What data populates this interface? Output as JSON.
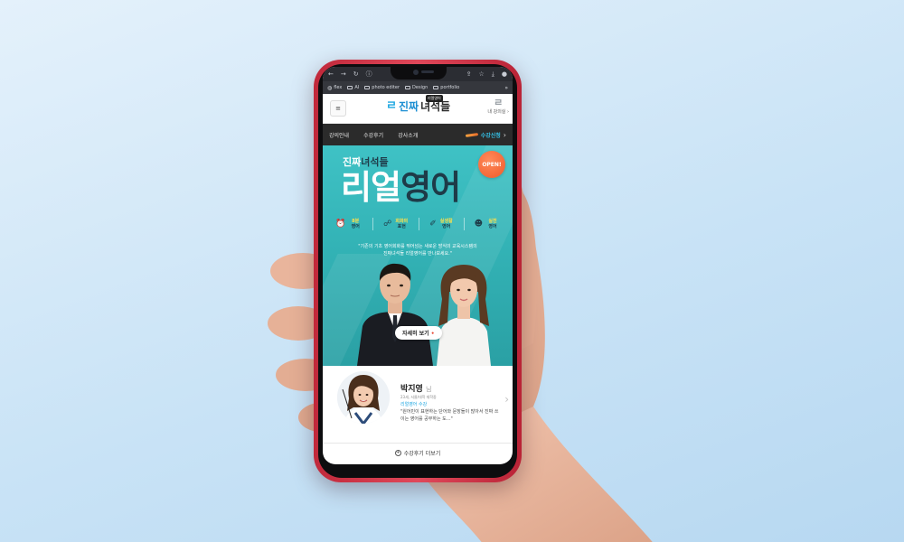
{
  "browser": {
    "nav_icons": [
      "back-icon",
      "forward-icon",
      "reload-icon",
      "info-icon",
      "share-icon",
      "star-icon",
      "download-icon",
      "profile-icon"
    ],
    "bookmarks": [
      {
        "label": "flex",
        "icon": "globe-icon"
      },
      {
        "label": "AI",
        "icon": "folder-icon"
      },
      {
        "label": "photo editer",
        "icon": "folder-icon"
      },
      {
        "label": "Design",
        "icon": "folder-icon"
      },
      {
        "label": "portfolio",
        "icon": "folder-icon"
      }
    ],
    "more": "»"
  },
  "header": {
    "menu_icon": "≡",
    "logo_mark": "ㄹ",
    "logo_part1": "진짜",
    "logo_part2": "녀석들",
    "logo_tag": "리얼영어",
    "mylec_icon": "ㄹ",
    "mylec_label": "내 강의실 ›"
  },
  "nav": {
    "items": [
      "강의안내",
      "수강후기",
      "강사소개"
    ],
    "enroll_label": "수강신청",
    "enroll_arrow": "›"
  },
  "hero": {
    "subtitle_part1": "진짜",
    "subtitle_part2": "녀석들",
    "badge": "OPEN!",
    "title_part1": "리얼",
    "title_part2": "영어",
    "features": [
      {
        "icon": "⏰",
        "line1": "8분",
        "line2": "영어"
      },
      {
        "icon": "☍",
        "line1": "회화의",
        "line2": "표현"
      },
      {
        "icon": "✐",
        "line1": "실생활",
        "line2": "영어"
      },
      {
        "icon": "☻",
        "line1": "실전",
        "line2": "영어"
      }
    ],
    "desc_line1": "\"기존의 기초 영어회화를 뛰어넘는 새로운 방식의 교육시스템의",
    "desc_line2": "진짜녀석들 리얼영어를 만나보세요.\"",
    "more_label": "자세히 보기",
    "more_dot": "•"
  },
  "review": {
    "name": "박지영",
    "honorific": "님",
    "info": "23세, 서울/대학 재학중",
    "course": "리얼영어 수강",
    "quote": "\"원어민이 표현하는 단어와 문장들이 많아서 진짜 쓰이는 영어를 공부하는 도...\"",
    "next_icon": "›"
  },
  "more_reviews": {
    "plus": "+",
    "label": "수강후기 더보기"
  },
  "colors": {
    "phone_body": "#d93a4c",
    "hero_teal": "#33b3b6",
    "accent_blue": "#1ea7e1",
    "title_dark": "#1e3b48",
    "badge_orange": "#f05a2a",
    "nav_bg": "#2b2b2b"
  }
}
